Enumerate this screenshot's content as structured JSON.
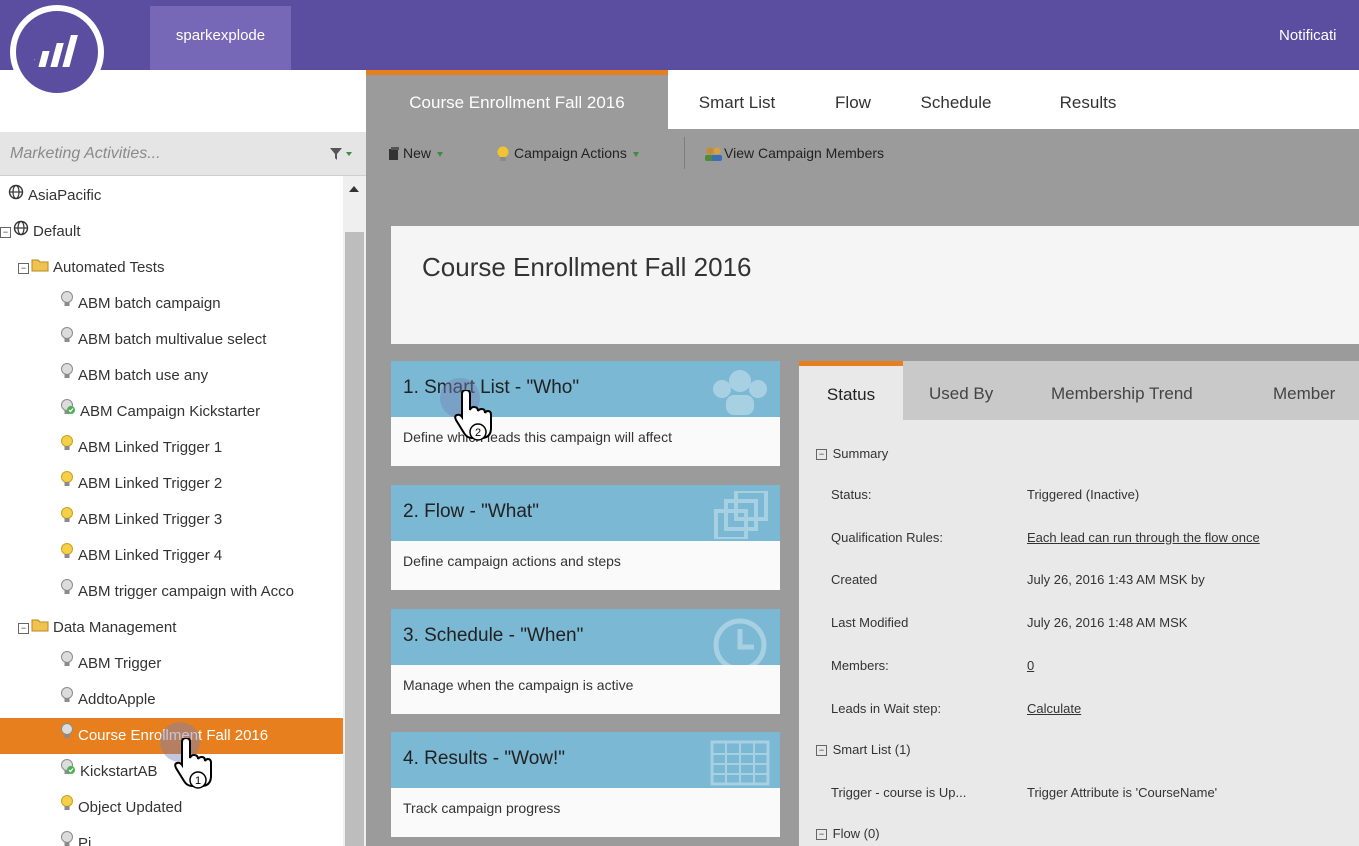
{
  "topbar": {
    "workspace": "sparkexplode",
    "notifications": "Notificati"
  },
  "sidebar": {
    "search_placeholder": "Marketing Activities...",
    "tree": [
      {
        "label": "AsiaPacific",
        "icon": "globe-icon",
        "indent": 0,
        "expander": false
      },
      {
        "label": "Default",
        "icon": "globe-icon",
        "indent": 0,
        "expander": true
      },
      {
        "label": "Automated Tests",
        "icon": "folder-icon",
        "indent": 1,
        "expander": true
      },
      {
        "label": "ABM batch campaign",
        "icon": "bulb-gray-icon",
        "indent": 2
      },
      {
        "label": "ABM batch multivalue select",
        "icon": "bulb-gray-icon",
        "indent": 2
      },
      {
        "label": "ABM batch use any",
        "icon": "bulb-gray-icon",
        "indent": 2
      },
      {
        "label": "ABM Campaign Kickstarter",
        "icon": "bulb-green-icon",
        "indent": 2
      },
      {
        "label": "ABM Linked Trigger 1",
        "icon": "bulb-yellow-icon",
        "indent": 2
      },
      {
        "label": "ABM Linked Trigger 2",
        "icon": "bulb-yellow-icon",
        "indent": 2
      },
      {
        "label": "ABM Linked Trigger 3",
        "icon": "bulb-yellow-icon",
        "indent": 2
      },
      {
        "label": "ABM Linked Trigger 4",
        "icon": "bulb-yellow-icon",
        "indent": 2
      },
      {
        "label": "ABM trigger campaign with Acco",
        "icon": "bulb-gray-icon",
        "indent": 2
      },
      {
        "label": "Data Management",
        "icon": "folder-icon",
        "indent": 1,
        "expander": true
      },
      {
        "label": "ABM Trigger",
        "icon": "bulb-gray-icon",
        "indent": 2
      },
      {
        "label": "AddtoApple",
        "icon": "bulb-gray-icon",
        "indent": 2
      },
      {
        "label": "Course Enrollment Fall 2016",
        "icon": "bulb-gray-icon",
        "indent": 2,
        "selected": true
      },
      {
        "label": "KickstartAB",
        "icon": "bulb-green-icon",
        "indent": 2
      },
      {
        "label": "Object Updated",
        "icon": "bulb-yellow-icon",
        "indent": 2
      },
      {
        "label": "Pi",
        "icon": "bulb-gray-icon",
        "indent": 2
      }
    ]
  },
  "tabs": [
    "Course Enrollment Fall 2016",
    "Smart List",
    "Flow",
    "Schedule",
    "Results"
  ],
  "toolbar": {
    "new_label": "New",
    "campaign_actions_label": "Campaign Actions",
    "view_members_label": "View Campaign Members"
  },
  "page_title": "Course Enrollment Fall 2016",
  "cards": [
    {
      "title": "1. Smart List - \"Who\"",
      "desc": "Define which leads this campaign will affect"
    },
    {
      "title": "2. Flow - \"What\"",
      "desc": "Define campaign actions and steps"
    },
    {
      "title": "3. Schedule - \"When\"",
      "desc": "Manage when the campaign is active"
    },
    {
      "title": "4. Results - \"Wow!\"",
      "desc": "Track campaign progress"
    }
  ],
  "panel_tabs": [
    "Status",
    "Used By",
    "Membership Trend",
    "Member"
  ],
  "status": {
    "summary_label": "Summary",
    "status_label": "Status:",
    "status_value": "Triggered (Inactive)",
    "qual_label": "Qualification Rules:",
    "qual_value": "Each lead can run through the flow once",
    "created_label": "Created",
    "created_value": "July 26, 2016 1:43 AM MSK by",
    "modified_label": "Last Modified",
    "modified_value": "July 26, 2016 1:48 AM MSK",
    "members_label": "Members:",
    "members_value": "0",
    "wait_label": "Leads in Wait step:",
    "wait_value": "Calculate",
    "smart_list_label": "Smart List (1)",
    "trigger_label": "Trigger - course is Up...",
    "trigger_value": "Trigger Attribute is 'CourseName'",
    "flow_label": "Flow (0)"
  },
  "cursor_badges": [
    "1",
    "2"
  ],
  "colors": {
    "brand": "#5b4d9f",
    "accent": "#e87f1e",
    "card_head": "#7ab8d4"
  }
}
